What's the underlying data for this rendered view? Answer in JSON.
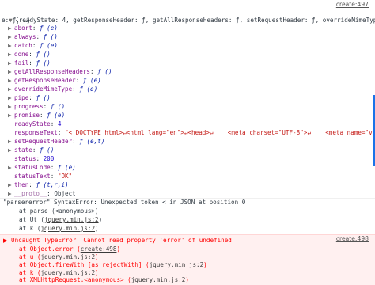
{
  "log1": {
    "source": "create:497",
    "object_summary": "{readyState: 4, getResponseHeader: ƒ, getAllResponseHeaders: ƒ, setRequestHeader: ƒ, overrideMimeTyp",
    "object_summary_cont": "e: ƒ, …}",
    "info_icon": "i",
    "properties": [
      {
        "key": "abort",
        "value": "ƒ (e)"
      },
      {
        "key": "always",
        "value": "ƒ ()"
      },
      {
        "key": "catch",
        "value": "ƒ (e)"
      },
      {
        "key": "done",
        "value": "ƒ ()"
      },
      {
        "key": "fail",
        "value": "ƒ ()"
      },
      {
        "key": "getAllResponseHeaders",
        "value": "ƒ ()"
      },
      {
        "key": "getResponseHeader",
        "value": "ƒ (e)"
      },
      {
        "key": "overrideMimeType",
        "value": "ƒ (e)"
      },
      {
        "key": "pipe",
        "value": "ƒ ()"
      },
      {
        "key": "progress",
        "value": "ƒ ()"
      },
      {
        "key": "promise",
        "value": "ƒ (e)"
      }
    ],
    "readyState_key": "readyState",
    "readyState_value": "4",
    "responseText_key": "responseText",
    "responseText_value": "\"<!DOCTYPE html>↵<html lang=\"en\">↵<head>↵    <meta charset=\"UTF-8\">↵    <meta name=\"vie",
    "properties2": [
      {
        "key": "setRequestHeader",
        "value": "ƒ (e,t)"
      },
      {
        "key": "state",
        "value": "ƒ ()"
      }
    ],
    "status_key": "status",
    "status_value": "200",
    "statusCode_key": "statusCode",
    "statusCode_value": "ƒ (e)",
    "statusText_key": "statusText",
    "statusText_value": "\"OK\"",
    "then_key": "then",
    "then_value": "ƒ (t,r,i)",
    "proto_key": "__proto__",
    "proto_value": "Object"
  },
  "parse_error": {
    "header": "\"parsererror\" SyntaxError: Unexpected token < in JSON at position 0",
    "stack": [
      {
        "prefix": "at parse (<anonymous>)",
        "link": ""
      },
      {
        "prefix": "at Ut (",
        "link": "jquery.min.js:2",
        "suffix": ")"
      },
      {
        "prefix": "at k (",
        "link": "jquery.min.js:2",
        "suffix": ")"
      },
      {
        "prefix": "at XMLHttpRequest.<anonymous> (",
        "link": "jquery.min.js:2",
        "suffix": ")"
      }
    ]
  },
  "error2": {
    "source": "create:498",
    "header": "Uncaught TypeError: Cannot read property 'error' of undefined",
    "stack": [
      {
        "prefix": "at Object.error (",
        "link": "create:498",
        "suffix": ")"
      },
      {
        "prefix": "at u (",
        "link": "jquery.min.js:2",
        "suffix": ")"
      },
      {
        "prefix": "at Object.fireWith [as rejectWith] (",
        "link": "jquery.min.js:2",
        "suffix": ")"
      },
      {
        "prefix": "at k (",
        "link": "jquery.min.js:2",
        "suffix": ")"
      },
      {
        "prefix": "at XMLHttpRequest.<anonymous> (",
        "link": "jquery.min.js:2",
        "suffix": ")"
      }
    ]
  },
  "colors": {
    "error_bg": "#fff0f0",
    "error_text": "#ff0000",
    "property_key": "#881391",
    "string_value": "#c41a16",
    "number_value": "#1c00cf",
    "scrollbar": "#1a73e8"
  }
}
